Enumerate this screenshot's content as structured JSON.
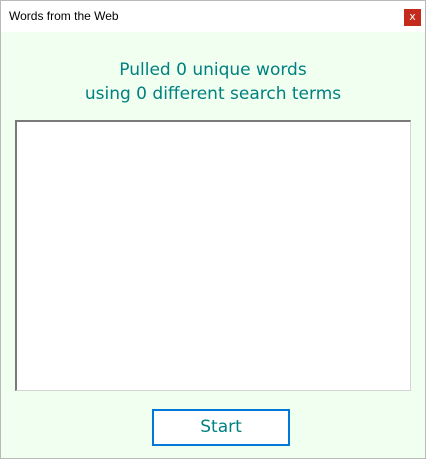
{
  "window": {
    "title": "Words from the Web",
    "close_glyph": "x"
  },
  "status": {
    "line1": "Pulled 0 unique words",
    "line2": "using 0 different search terms"
  },
  "word_list": {
    "items": []
  },
  "actions": {
    "start_label": "Start"
  },
  "colors": {
    "background": "#f0fff0",
    "accent_text": "#008080",
    "focus_border": "#0078d7",
    "close_button": "#c42b1c"
  }
}
